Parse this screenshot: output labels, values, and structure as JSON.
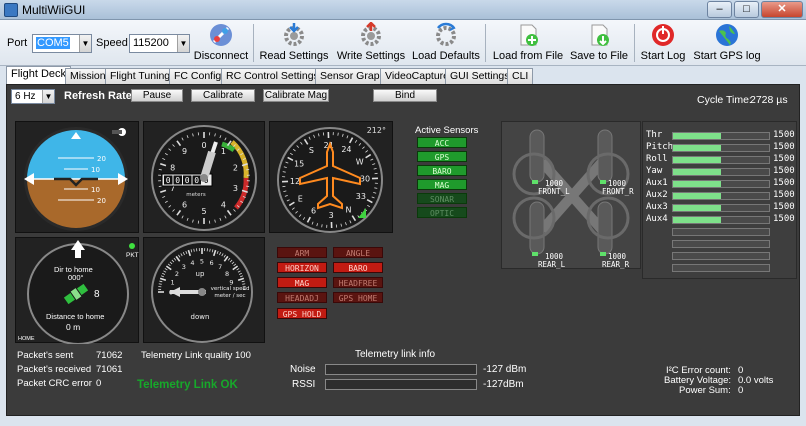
{
  "window": {
    "title": "MultiWiiGUI",
    "minimize": "–",
    "maximize": "□",
    "close": "✕"
  },
  "toolbar": {
    "port_label": "Port",
    "port_value": "COM5",
    "speed_label": "Speed",
    "speed_value": "115200",
    "disconnect": "Disconnect",
    "read_settings": "Read Settings",
    "write_settings": "Write Settings",
    "load_defaults": "Load Defaults",
    "load_from_file": "Load from File",
    "save_to_file": "Save to File",
    "start_log": "Start Log",
    "start_gps_log": "Start GPS log"
  },
  "tabs": [
    {
      "label": "Flight Deck",
      "active": true
    },
    {
      "label": "Mission"
    },
    {
      "label": "Flight Tuning"
    },
    {
      "label": "FC Config"
    },
    {
      "label": "RC Control Settings"
    },
    {
      "label": "Sensor Graph"
    },
    {
      "label": "VideoCapture"
    },
    {
      "label": "GUI Settings"
    },
    {
      "label": "CLI"
    }
  ],
  "controls": {
    "rate_value": "6 Hz",
    "refresh_rate_label": "Refresh Rate",
    "pause": "Pause",
    "calibrate": "Calibrate",
    "calibrate_mag": "Calibrate Mag",
    "bind": "Bind",
    "cycle_time_label": "Cycle Time:",
    "cycle_time_value": "2728 µs"
  },
  "horizon": {
    "pitch_labels": [
      "20",
      "10",
      "10",
      "20"
    ]
  },
  "altimeter": {
    "digits": [
      "0",
      "0",
      "0",
      "0",
      "0"
    ],
    "unit": "meters",
    "numbers": [
      "0",
      "1",
      "2",
      "3",
      "4",
      "5",
      "6",
      "7",
      "8",
      "9"
    ]
  },
  "compass": {
    "heading_readout": "212°",
    "marks": [
      "N",
      "3",
      "6",
      "E",
      "12",
      "15",
      "S",
      "21",
      "24",
      "W",
      "30",
      "33"
    ]
  },
  "gps": {
    "dir_label": "Dir to home",
    "dir_value": "000°",
    "sats": "8",
    "dist_label": "Distance to home",
    "dist_value": "0 m",
    "pkt": "PKT",
    "home": "HOME"
  },
  "vario": {
    "up": "up",
    "down": "down",
    "caption1": "vertical speed",
    "caption2": "meter / sec",
    "numbers": [
      "0",
      "1",
      "2",
      "3",
      "4",
      "5",
      "6",
      "7",
      "8",
      "9"
    ]
  },
  "active_sensors": {
    "title": "Active Sensors",
    "items": [
      {
        "label": "ACC",
        "on": true
      },
      {
        "label": "GPS",
        "on": true
      },
      {
        "label": "BARO",
        "on": true
      },
      {
        "label": "MAG",
        "on": true
      },
      {
        "label": "SONAR",
        "on": false
      },
      {
        "label": "OPTIC",
        "on": false
      }
    ]
  },
  "flight_modes": [
    {
      "label": "ARM",
      "on": false
    },
    {
      "label": "ANGLE",
      "on": false
    },
    {
      "label": "HORIZON",
      "on": true
    },
    {
      "label": "BARO",
      "on": true
    },
    {
      "label": "MAG",
      "on": true
    },
    {
      "label": "HEADFREE",
      "on": false
    },
    {
      "label": "HEADADJ",
      "on": false
    },
    {
      "label": "GPS HOME",
      "on": false
    },
    {
      "label": "GPS HOLD",
      "on": true
    }
  ],
  "motors": [
    {
      "value": "1000",
      "name": "FRONT_L"
    },
    {
      "value": "1000",
      "name": "FRONT_R"
    },
    {
      "value": "1000",
      "name": "REAR_L"
    },
    {
      "value": "1000",
      "name": "REAR_R"
    }
  ],
  "rc": [
    {
      "name": "Thr",
      "value": "1500",
      "level": 0.5
    },
    {
      "name": "Pitch",
      "value": "1500",
      "level": 0.5
    },
    {
      "name": "Roll",
      "value": "1500",
      "level": 0.5
    },
    {
      "name": "Yaw",
      "value": "1500",
      "level": 0.5
    },
    {
      "name": "Aux1",
      "value": "1500",
      "level": 0.5
    },
    {
      "name": "Aux2",
      "value": "1500",
      "level": 0.5
    },
    {
      "name": "Aux3",
      "value": "1500",
      "level": 0.5
    },
    {
      "name": "Aux4",
      "value": "1500",
      "level": 0.5
    }
  ],
  "packets": {
    "sent_label": "Packet's sent",
    "sent_value": "71062",
    "received_label": "Packet's received",
    "received_value": "71061",
    "crc_label": "Packet CRC error",
    "crc_value": "0"
  },
  "telemetry": {
    "quality_label": "Telemetry Link quality",
    "quality_value": "100",
    "status": "Telemetry Link OK",
    "info_title": "Telemetry link info",
    "noise_label": "Noise",
    "noise_value": "-127 dBm",
    "rssi_label": "RSSI",
    "rssi_value": "-127dBm"
  },
  "status": {
    "i2c_label": "I²C Error count:",
    "i2c_value": "0",
    "battery_label": "Battery Voltage:",
    "battery_value": "0.0 volts",
    "power_label": "Power Sum:",
    "power_value": "0"
  },
  "colors": {
    "panel": "#3b3b3b",
    "sensor_on": "#1f9a2c",
    "mode_on": "#c21b12",
    "rc_fill": "#7ee08a",
    "sky": "#3fb6e8",
    "ground": "#a9692b"
  }
}
